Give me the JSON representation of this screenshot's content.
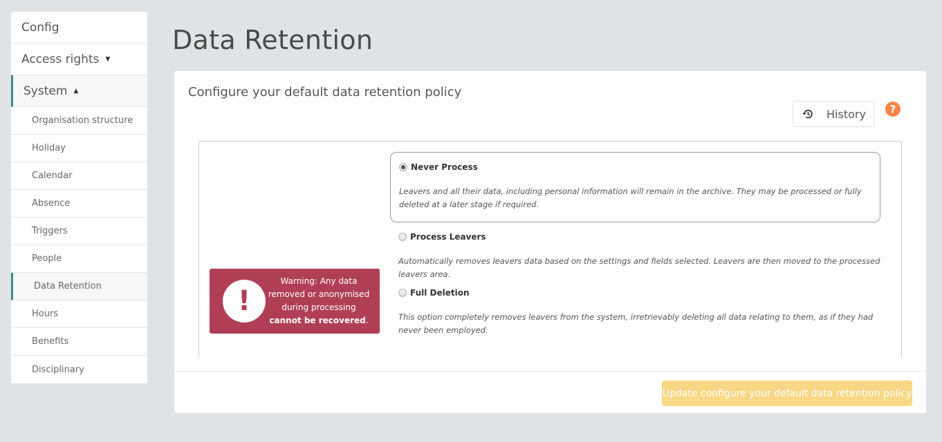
{
  "sidebar": {
    "top_items": [
      {
        "label": "Config",
        "caret": ""
      },
      {
        "label": "Access rights",
        "caret": "▼"
      },
      {
        "label": "System",
        "caret": "▲"
      }
    ],
    "sub_items": [
      {
        "label": "Organisation structure"
      },
      {
        "label": "Holiday"
      },
      {
        "label": "Calendar"
      },
      {
        "label": "Absence"
      },
      {
        "label": "Triggers"
      },
      {
        "label": "People"
      },
      {
        "label": "Data Retention"
      },
      {
        "label": "Hours"
      },
      {
        "label": "Benefits"
      },
      {
        "label": "Disciplinary"
      }
    ]
  },
  "page": {
    "title": "Data Retention"
  },
  "card": {
    "title": "Configure your default data retention policy",
    "history_label": "History",
    "help_symbol": "?",
    "warning": {
      "symbol": "!",
      "text_plain": "Warning: Any data removed or anonymised during processing",
      "text_bold": "cannot be recovered",
      "text_end": "."
    },
    "options": [
      {
        "label": "Never Process",
        "checked": true,
        "description": "Leavers and all their data, including personal information will remain in the archive. They may be processed or fully deleted at a later stage if required."
      },
      {
        "label": "Process Leavers",
        "checked": false,
        "description": "Automatically removes leavers data based on the settings and fields selected. Leavers are then moved to the processed leavers area."
      },
      {
        "label": "Full Deletion",
        "checked": false,
        "description": "This option completely removes leavers from the system, irretrievably deleting all data relating to them, as if they had never been employed."
      }
    ],
    "update_button": "Update configure your default data retention policy"
  },
  "colors": {
    "accent": "#3a8a8c",
    "warning_bg": "#b03f55",
    "help": "#f7844a",
    "update_button": "#f8d57f"
  }
}
